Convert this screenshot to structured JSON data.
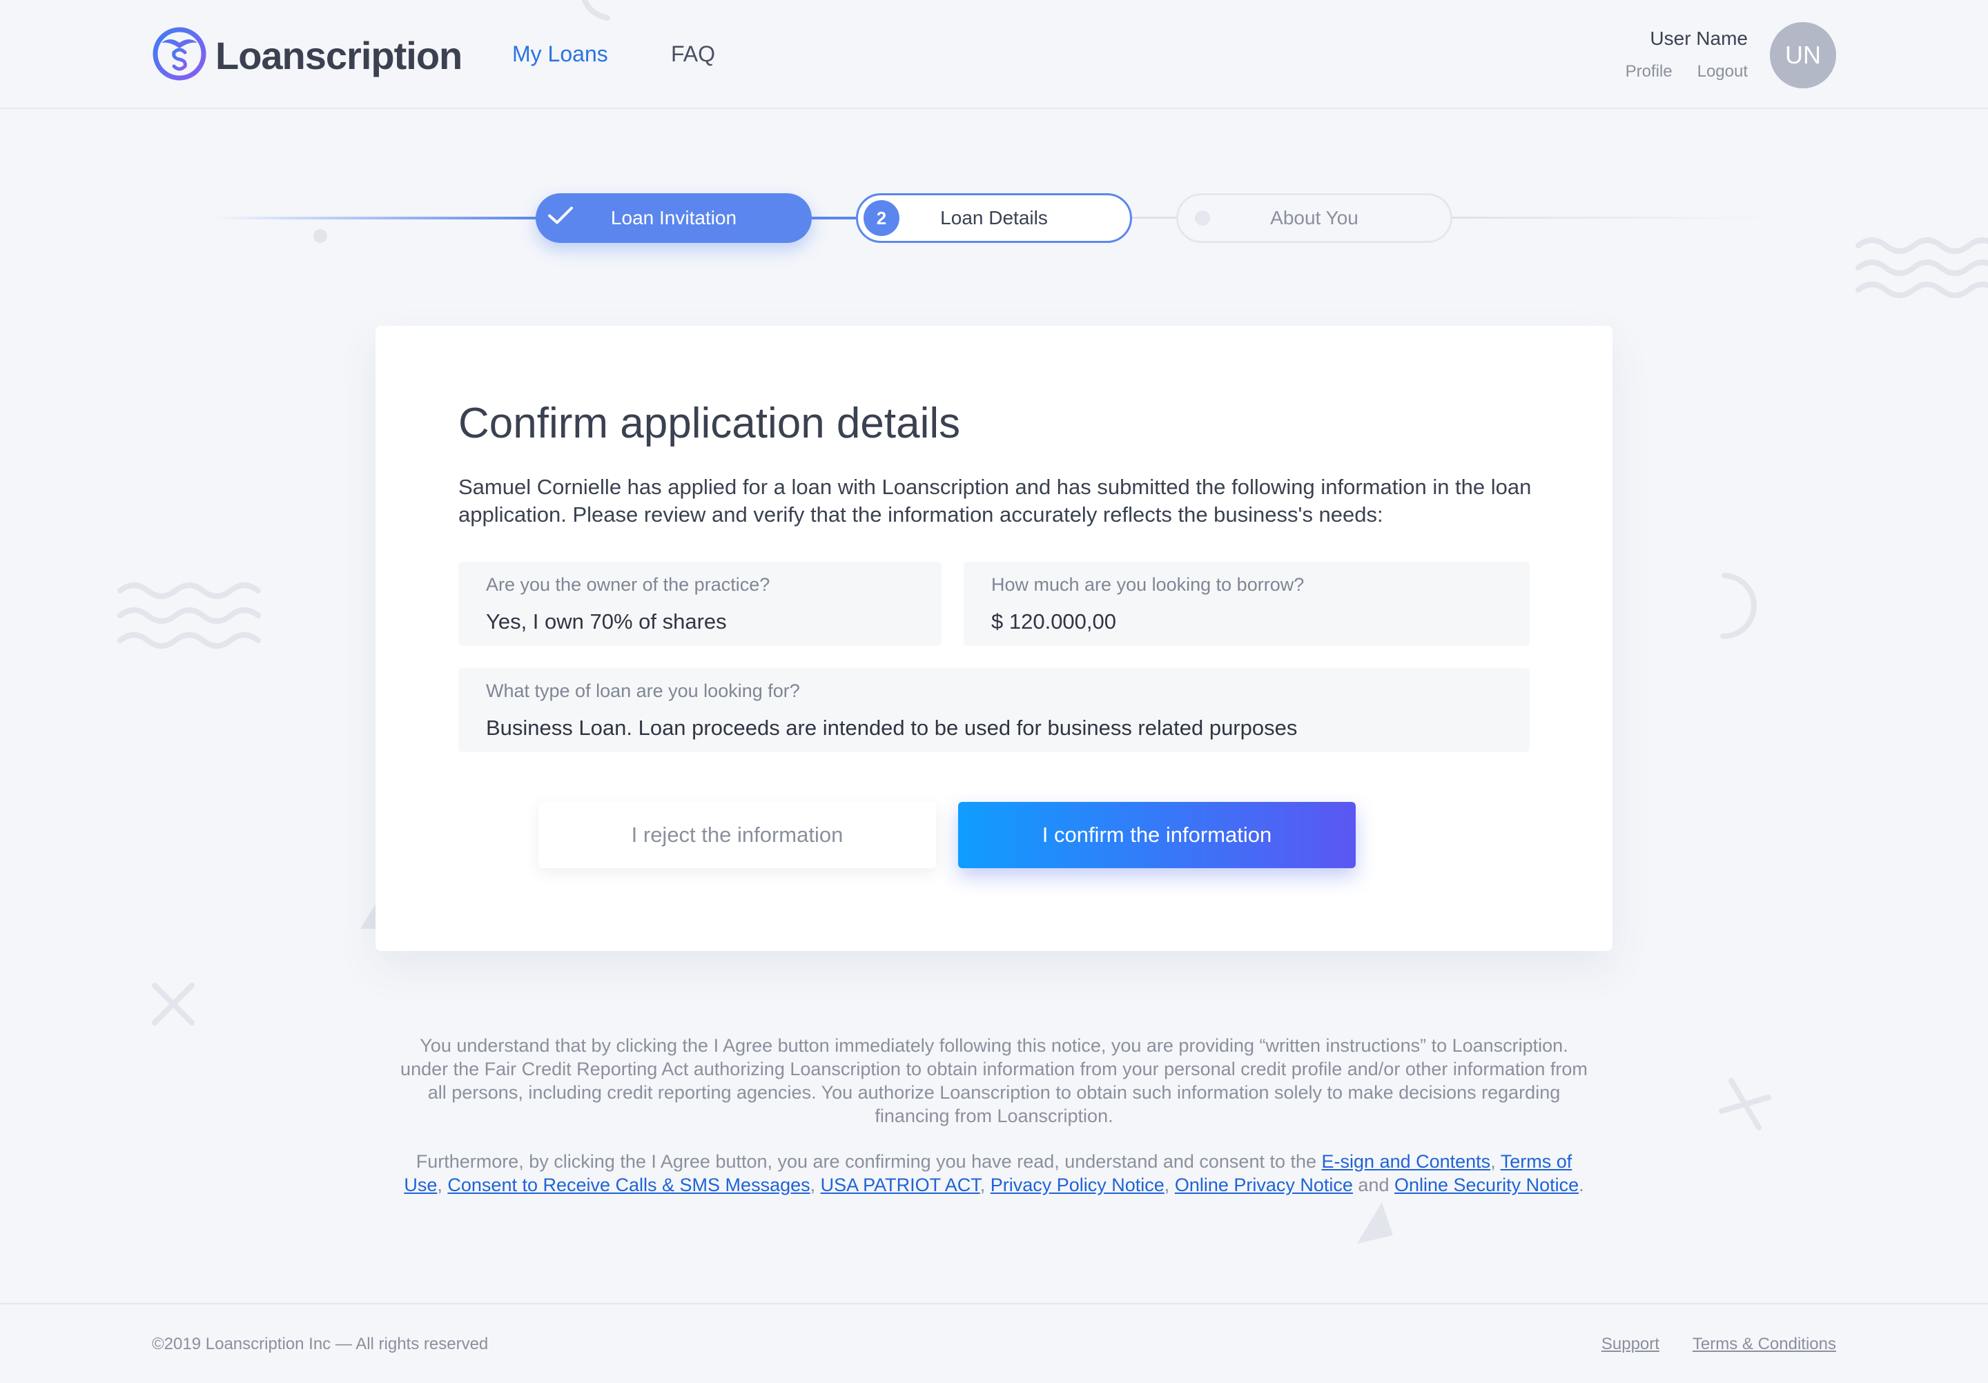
{
  "header": {
    "brand": "Loanscription",
    "nav": {
      "my_loans": "My Loans",
      "faq": "FAQ"
    },
    "user": {
      "name": "User Name",
      "profile": "Profile",
      "logout": "Logout",
      "initials": "UN"
    }
  },
  "stepper": {
    "steps": [
      {
        "label": "Loan Invitation",
        "state": "completed",
        "icon": "check-icon"
      },
      {
        "label": "Loan Details",
        "state": "active",
        "number": "2"
      },
      {
        "label": "About You",
        "state": "upcoming"
      }
    ]
  },
  "card": {
    "title": "Confirm application details",
    "intro": "Samuel Cornielle has applied for a loan with Loanscription and has submitted the following information in the loan application. Please review and verify that the information accurately reflects the business's needs:",
    "fields": {
      "owner": {
        "label": "Are you the owner of the practice?",
        "value": "Yes, I own 70% of shares"
      },
      "amount": {
        "label": "How much are you looking to borrow?",
        "value": "$ 120.000,00"
      },
      "loan_type": {
        "label": "What type of loan are you looking for?",
        "value": "Business Loan. Loan proceeds are intended to be used for business related purposes"
      }
    },
    "buttons": {
      "reject": "I reject the information",
      "confirm": "I confirm the information"
    }
  },
  "notice": {
    "paragraph1": "You understand that by clicking the I Agree button immediately following this notice, you are providing “written instructions” to Loanscription. under the Fair Credit Reporting Act authorizing Loanscription to obtain information from your personal credit profile and/or other information from all persons, including credit reporting agencies. You authorize Loanscription to obtain such information solely to make decisions regarding financing from Loanscription.",
    "paragraph2_intro": "Furthermore, by clicking the I Agree button, you are confirming you have read, understand and consent to the ",
    "links": {
      "esign": "E-sign and Contents",
      "terms_of_use": "Terms of Use",
      "consent_calls": "Consent to Receive Calls & SMS Messages",
      "patriot_act": "USA PATRIOT ACT",
      "privacy_policy": "Privacy Policy Notice",
      "online_privacy": "Online Privacy Notice",
      "online_security": "Online Security Notice"
    },
    "sep_comma": ", ",
    "sep_and": " and ",
    "end": "."
  },
  "footer": {
    "copyright": "©2019 Loanscription Inc — All rights reserved",
    "support": "Support",
    "terms": "Terms & Conditions"
  },
  "colors": {
    "accent": "#5b86ee",
    "nav_active": "#2b73e0",
    "link": "#1f63d6",
    "confirm_gradient_start": "#0f9dff",
    "confirm_gradient_end": "#5b57f2",
    "background": "#f4f6fa"
  }
}
